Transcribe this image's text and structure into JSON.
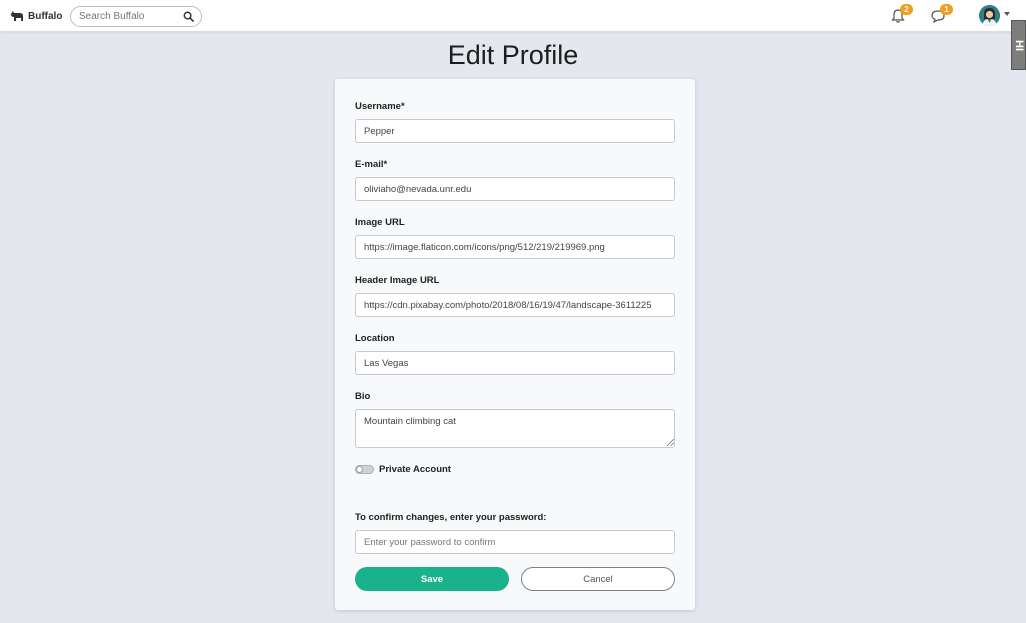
{
  "nav": {
    "brand": "Buffalo",
    "search_placeholder": "Search Buffalo",
    "notifications_count": "2",
    "messages_count": "1"
  },
  "edge_tab": "HI",
  "page": {
    "title": "Edit Profile"
  },
  "form": {
    "username": {
      "label": "Username*",
      "value": "Pepper"
    },
    "email": {
      "label": "E-mail*",
      "value": "oliviaho@nevada.unr.edu"
    },
    "image_url": {
      "label": "Image URL",
      "value": "https://image.flaticon.com/icons/png/512/219/219969.png"
    },
    "header_image_url": {
      "label": "Header Image URL",
      "value": "https://cdn.pixabay.com/photo/2018/08/16/19/47/landscape-3611225"
    },
    "location": {
      "label": "Location",
      "value": "Las Vegas"
    },
    "bio": {
      "label": "Bio",
      "value": "Mountain climbing cat"
    },
    "private_account": {
      "label": "Private Account",
      "checked": false
    },
    "confirm": {
      "label": "To confirm changes, enter your password:",
      "placeholder": "Enter your password to confirm"
    },
    "save_label": "Save",
    "cancel_label": "Cancel"
  },
  "colors": {
    "accent": "#19b28c",
    "badge": "#f0a01c",
    "background": "#e4e8ee"
  }
}
